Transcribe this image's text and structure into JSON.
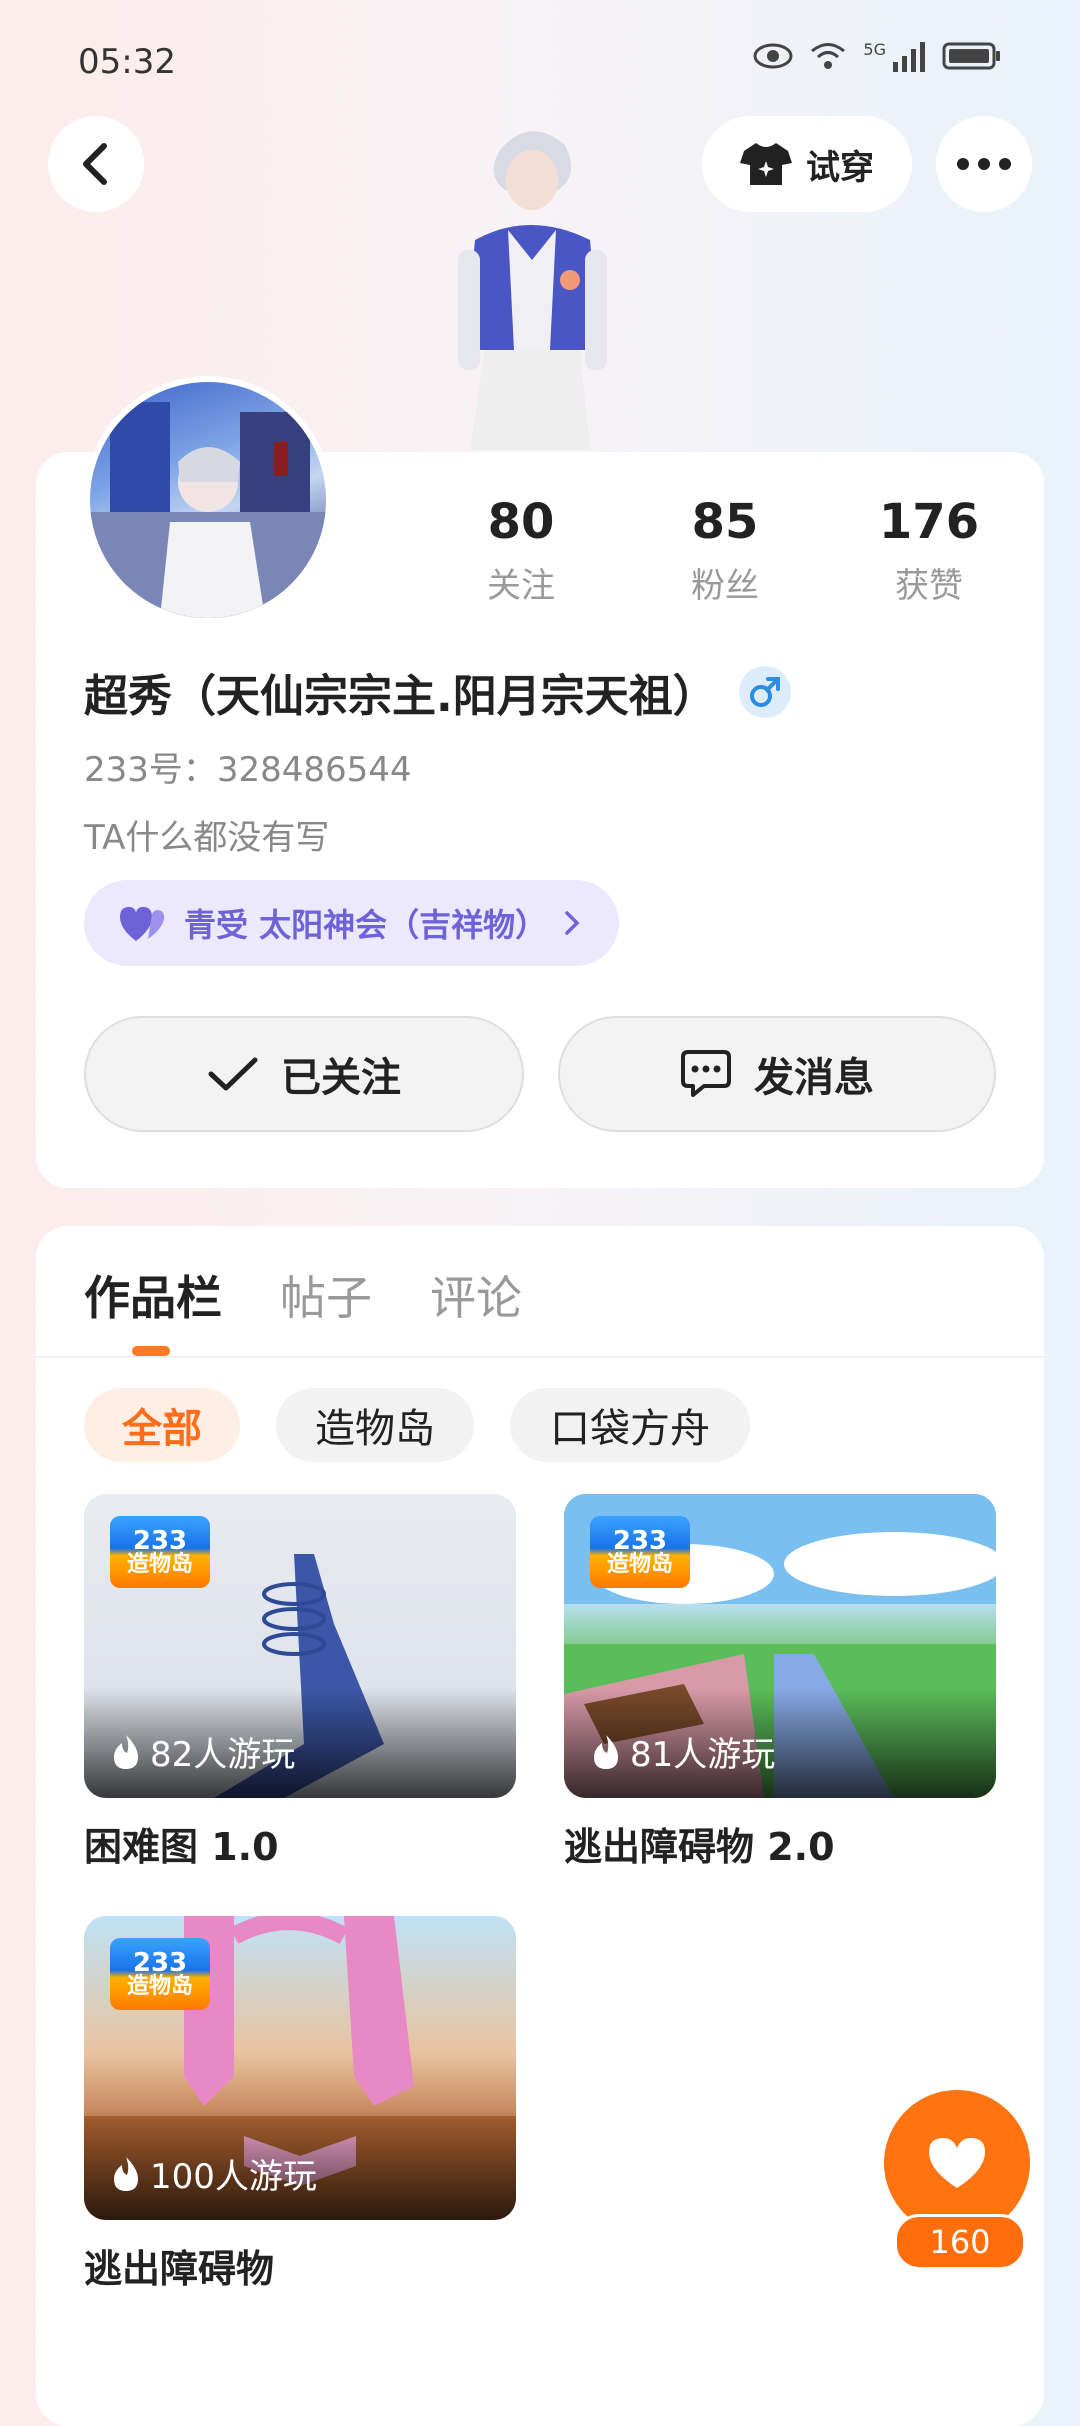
{
  "status_bar": {
    "time": "05:32",
    "network": "5G"
  },
  "header": {
    "try_on_label": "试穿"
  },
  "profile": {
    "name": "超秀（天仙宗宗主.阳月宗天祖）",
    "uid_text": "233号：328486544",
    "bio": "TA什么都没有写",
    "stats": [
      {
        "value": "80",
        "label": "关注"
      },
      {
        "value": "85",
        "label": "粉丝"
      },
      {
        "value": "176",
        "label": "获赞"
      }
    ],
    "tag": "青受 太阳神会（吉祥物）",
    "follow_button": "已关注",
    "message_button": "发消息"
  },
  "content_tabs": [
    {
      "label": "作品栏",
      "active": true
    },
    {
      "label": "帖子",
      "active": false
    },
    {
      "label": "评论",
      "active": false
    }
  ],
  "filter_chips": [
    {
      "label": "全部",
      "active": true
    },
    {
      "label": "造物岛",
      "active": false
    },
    {
      "label": "口袋方舟",
      "active": false
    }
  ],
  "games": [
    {
      "title": "困难图 1.0",
      "plays": "82人游玩",
      "badge_top": "233",
      "badge_bottom": "造物岛"
    },
    {
      "title": "逃出障碍物 2.0",
      "plays": "81人游玩",
      "badge_top": "233",
      "badge_bottom": "造物岛"
    },
    {
      "title": "逃出障碍物",
      "plays": "100人游玩",
      "badge_top": "233",
      "badge_bottom": "造物岛"
    }
  ],
  "like_fab": {
    "count": "160"
  },
  "colors": {
    "accent": "#ff7411",
    "tag_text": "#6f62d9",
    "tag_bg": "#ebe9fb"
  }
}
